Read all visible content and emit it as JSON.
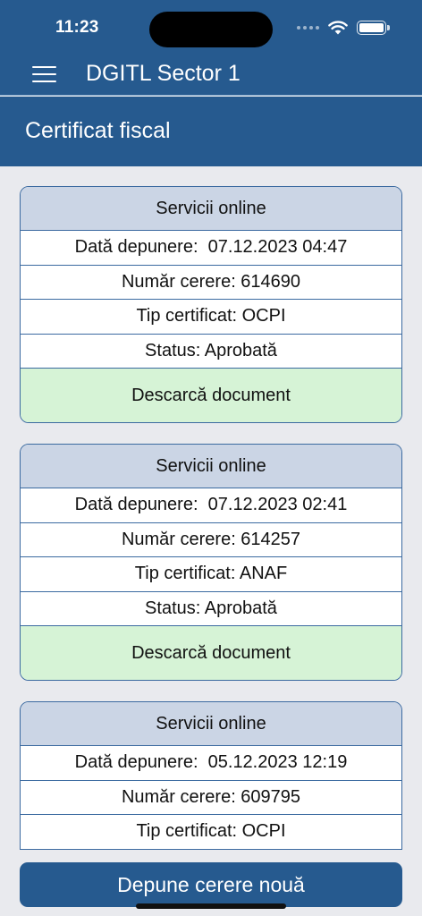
{
  "status_bar": {
    "time": "11:23"
  },
  "app_bar": {
    "title": "DGITL Sector 1"
  },
  "page": {
    "title": "Certificat fiscal"
  },
  "requests": [
    {
      "source": "Servicii online",
      "submission_date": "Dată depunere:  07.12.2023 04:47",
      "request_number": "Număr cerere: 614690",
      "certificate_type": "Tip certificat: OCPI",
      "status": "Status: Aprobată",
      "action": "Descarcă document"
    },
    {
      "source": "Servicii online",
      "submission_date": "Dată depunere:  07.12.2023 02:41",
      "request_number": "Număr cerere: 614257",
      "certificate_type": "Tip certificat: ANAF",
      "status": "Status: Aprobată",
      "action": "Descarcă document"
    },
    {
      "source": "Servicii online",
      "submission_date": "Dată depunere:  05.12.2023 12:19",
      "request_number": "Număr cerere: 609795",
      "certificate_type": "Tip certificat: OCPI"
    }
  ],
  "footer": {
    "new_request_label": "Depune cerere nouă"
  },
  "colors": {
    "primary": "#265a8f",
    "card_header": "#cbd5e5",
    "download_bg": "#d6f3d6",
    "page_bg": "#e9eaee"
  },
  "icons": {
    "menu": "hamburger-menu-icon",
    "wifi": "wifi-icon",
    "battery": "battery-icon",
    "signal": "cellular-signal-icon"
  }
}
